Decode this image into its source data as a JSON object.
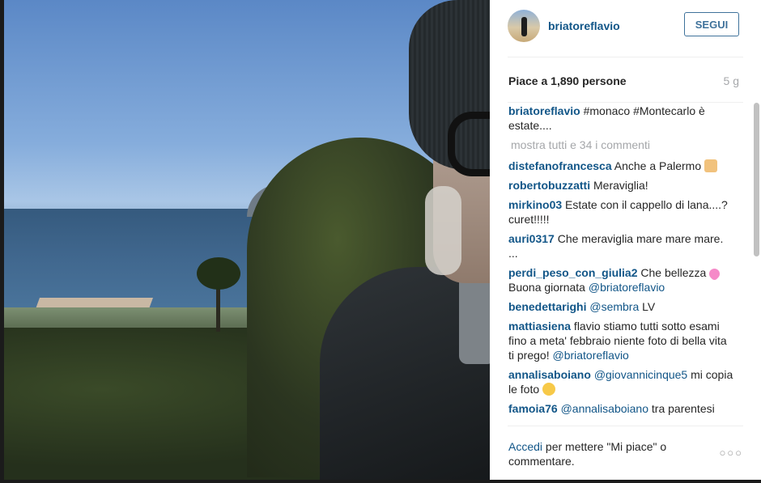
{
  "post": {
    "username": "briatoreflavio",
    "follow_label": "SEGUI",
    "likes_text": "Piace a 1,890 persone",
    "time_ago": "5 g",
    "caption": {
      "user": "briatoreflavio",
      "text": " #monaco #Montecarlo è estate...."
    },
    "load_more": "mostra tutti e 34 i commenti",
    "comments": [
      {
        "user": "distefanofrancesca",
        "text": " Anche a Palermo ",
        "emoji": "thumbs-up-icon"
      },
      {
        "user": "robertobuzzatti",
        "text": " Meraviglia!"
      },
      {
        "user": "mirkino03",
        "text": " Estate con il cappello di lana....?curet!!!!!"
      },
      {
        "user": "auri0317",
        "text": " Che meraviglia mare mare mare. ..."
      },
      {
        "user": "perdi_peso_con_giulia2",
        "text": " Che bellezza ",
        "emoji": "sparkling-heart-icon",
        "text2": " Buona giornata ",
        "mention": "@briatoreflavio"
      },
      {
        "user": "benedettarighi",
        "mention": "@sembra",
        "text": " LV"
      },
      {
        "user": "mattiasiena",
        "text": " flavio stiamo tutti sotto esami fino a meta' febbraio niente foto di bella vita ti prego! ",
        "mention": "@briatoreflavio"
      },
      {
        "user": "annalisaboiano",
        "mention": "@giovannicinque5",
        "text": " mi copia le foto ",
        "emoji": "laughing-tears-icon"
      },
      {
        "user": "famoia76",
        "mention": "@annalisaboiano",
        "text": " tra parentesi"
      }
    ],
    "footer": {
      "login_link": "Accedi",
      "rest": " per mettere \"Mi piace\" o commentare."
    },
    "more_options": "○○○"
  }
}
